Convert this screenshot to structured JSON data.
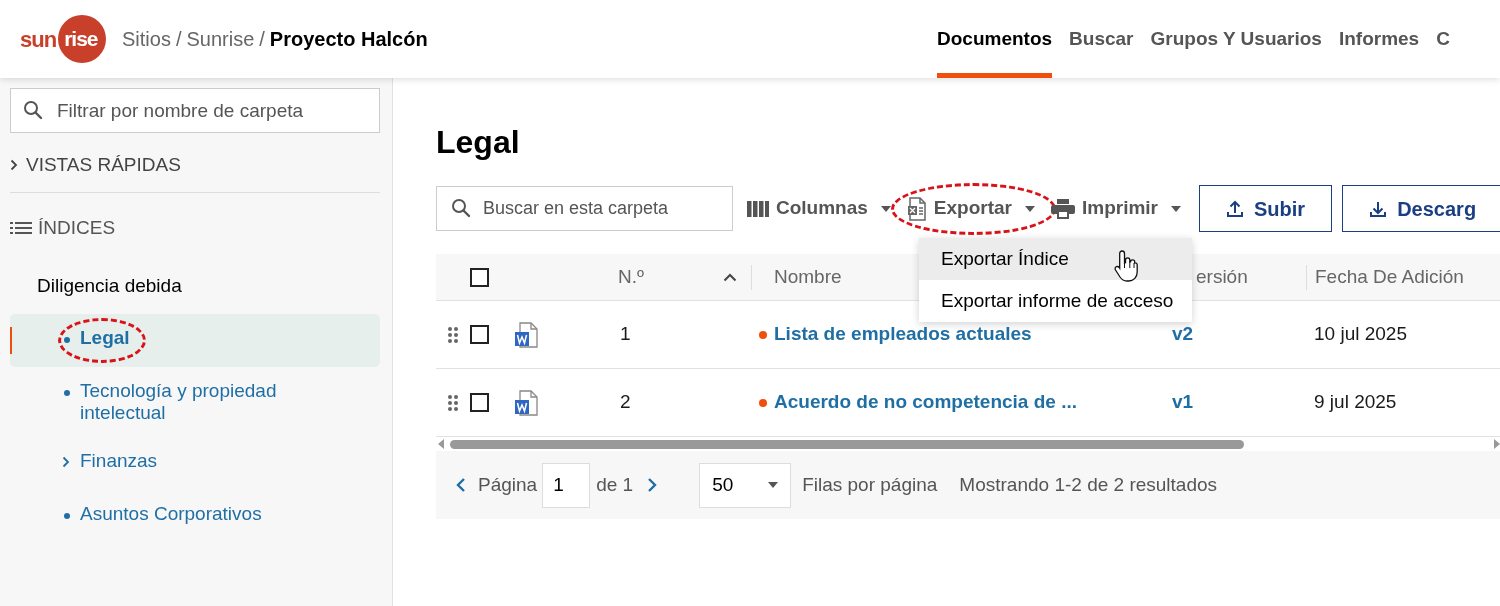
{
  "header": {
    "logo": {
      "outside": "sun",
      "inside": "rise"
    },
    "breadcrumb": [
      {
        "label": "Sitios",
        "current": false
      },
      {
        "label": "Sunrise",
        "current": false
      },
      {
        "label": "Proyecto Halcón",
        "current": true
      }
    ],
    "separator": "/",
    "nav": [
      {
        "label": "Documentos",
        "selected": true
      },
      {
        "label": "Buscar",
        "selected": false
      },
      {
        "label": "Grupos Y Usuarios",
        "selected": false
      },
      {
        "label": "Informes",
        "selected": false
      },
      {
        "label": "C",
        "selected": false
      }
    ]
  },
  "sidebar": {
    "filter_placeholder": "Filtrar por nombre de carpeta",
    "quick_views": {
      "label": "VISTAS RÁPIDAS",
      "expanded": false
    },
    "indices_label": "ÍNDICES",
    "tree": [
      {
        "label": "Diligencia debida",
        "children": [
          {
            "label": "Legal",
            "kind": "leaf",
            "selected": true,
            "annotated": true
          },
          {
            "label": "Tecnología y propiedad intelectual",
            "kind": "leaf",
            "selected": false,
            "annotated": false
          },
          {
            "label": "Finanzas",
            "kind": "folder",
            "selected": false,
            "annotated": false
          },
          {
            "label": "Asuntos Corporativos",
            "kind": "leaf",
            "selected": false,
            "annotated": false
          }
        ]
      }
    ]
  },
  "page": {
    "title": "Legal"
  },
  "toolbar": {
    "search_placeholder": "Buscar en esta carpeta",
    "actions": [
      {
        "label": "Columnas",
        "kind": "columns",
        "annotated": false
      },
      {
        "label": "Exportar",
        "kind": "export",
        "annotated": true
      },
      {
        "label": "Imprimir",
        "kind": "print",
        "annotated": false
      }
    ],
    "buttons": [
      {
        "label": "Subir",
        "kind": "upload"
      },
      {
        "label": "Descarg",
        "kind": "download"
      }
    ]
  },
  "export_menu": {
    "items": [
      {
        "label": "Exportar Índice",
        "hovered": true
      },
      {
        "label": "Exportar informe de acceso",
        "hovered": false
      }
    ]
  },
  "table": {
    "columns": [
      "N.º",
      "Nombre",
      "ersión",
      "Fecha De Adición"
    ],
    "all_checked": false,
    "rows": [
      {
        "checked": false,
        "number": "1",
        "name": "Lista de empleados actuales",
        "new": true,
        "version": "v2",
        "date": "10 jul 2025"
      },
      {
        "checked": false,
        "number": "2",
        "name": "Acuerdo de no competencia de ...",
        "new": true,
        "version": "v1",
        "date": "9 jul 2025"
      }
    ]
  },
  "pagination": {
    "page_label": "Página",
    "page": "1",
    "of": "de 1",
    "page_size": "50",
    "page_size_label": "Filas por página",
    "summary": "Mostrando 1-2 de 2 resultados"
  }
}
